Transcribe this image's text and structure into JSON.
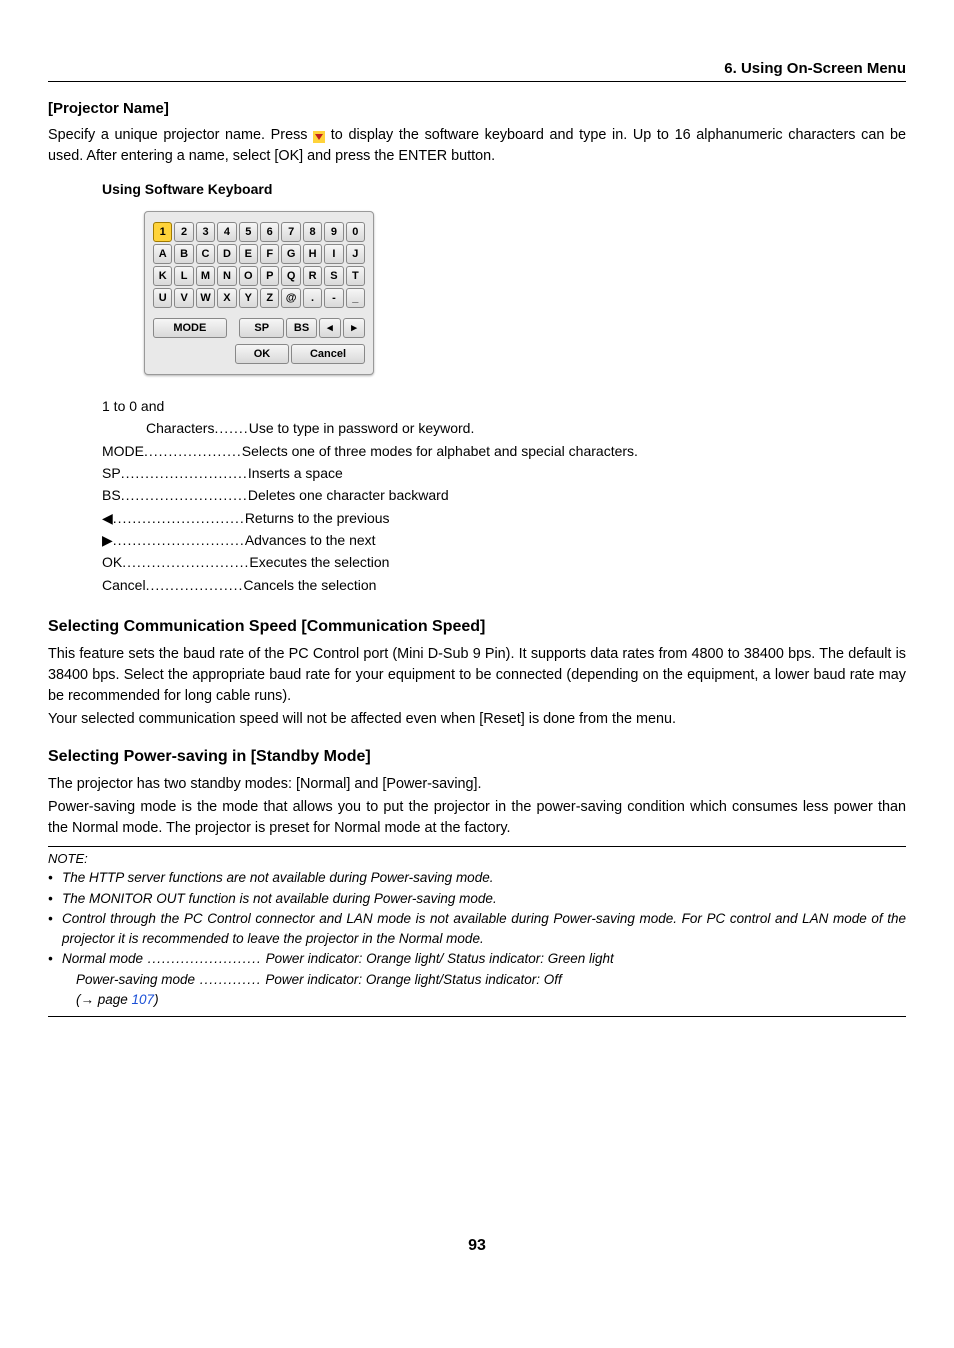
{
  "running_head": "6. Using On-Screen Menu",
  "projector": {
    "heading": "[Projector Name]",
    "para_a": "Specify a unique projector name. Press ",
    "para_b": " to display the software keyboard and type in. Up to 16 alphanumeric characters can be used. After entering a name, select [OK] and press the ENTER button.",
    "kbd_heading": "Using Software Keyboard"
  },
  "keyboard": {
    "row1": [
      "1",
      "2",
      "3",
      "4",
      "5",
      "6",
      "7",
      "8",
      "9",
      "0"
    ],
    "row2": [
      "A",
      "B",
      "C",
      "D",
      "E",
      "F",
      "G",
      "H",
      "I",
      "J"
    ],
    "row3": [
      "K",
      "L",
      "M",
      "N",
      "O",
      "P",
      "Q",
      "R",
      "S",
      "T"
    ],
    "row4": [
      "U",
      "V",
      "W",
      "X",
      "Y",
      "Z",
      "@",
      ".",
      "-",
      "_"
    ],
    "mode": "MODE",
    "sp": "SP",
    "bs": "BS",
    "left": "◂",
    "right": "▸",
    "ok": "OK",
    "cancel": "Cancel"
  },
  "defs": {
    "lead": "1 to 0 and",
    "chars_term": "Characters",
    "chars_dots": " .......",
    "chars_desc": " Use to type in password or keyword.",
    "mode_term": "MODE",
    "mode_dots": " ....................",
    "mode_desc": " Selects one of three modes for alphabet and special characters.",
    "sp_term": "SP",
    "sp_dots": " ..........................",
    "sp_desc": " Inserts a space",
    "bs_term": "BS",
    "bs_dots": " ..........................",
    "bs_desc": " Deletes one character backward",
    "left_term": "◀",
    "left_dots": " ...........................",
    "left_desc": " Returns to the previous",
    "right_term": "▶",
    "right_dots": " ...........................",
    "right_desc": " Advances to the next",
    "ok_term": "OK",
    "ok_dots": " ..........................",
    "ok_desc": " Executes the selection",
    "cancel_term": "Cancel",
    "cancel_dots": " ....................",
    "cancel_desc": " Cancels the selection"
  },
  "comm": {
    "heading": "Selecting Communication Speed [Communication Speed]",
    "p1": "This feature sets the baud rate of the PC Control port (Mini D-Sub 9 Pin). It supports data rates from 4800 to 38400 bps. The default is 38400 bps. Select the appropriate baud rate for your equipment to be connected (depending on the equipment, a lower baud rate may be recommended for long cable runs).",
    "p2": "Your selected communication speed will not be affected even when [Reset] is done from the menu."
  },
  "standby": {
    "heading": "Selecting Power-saving in [Standby Mode]",
    "p1": "The projector has two standby modes: [Normal] and [Power-saving].",
    "p2": "Power-saving mode is the mode that allows you to put the projector in the power-saving condition which consumes less power than the Normal mode. The projector is preset for Normal mode at the factory."
  },
  "note": {
    "label": "NOTE:",
    "b1": "The HTTP server functions are not available during Power-saving mode.",
    "b2": "The MONITOR OUT function is not available during Power-saving mode.",
    "b3": "Control through the PC Control connector and LAN mode is not available during Power-saving mode. For PC control and LAN mode of the projector it is recommended to leave the projector in the Normal mode.",
    "b4a_term": "Normal mode",
    "b4a_dots": " ........................",
    "b4a_desc": " Power indicator: Orange light/ Status indicator: Green light",
    "b4b_term": "Power-saving mode",
    "b4b_dots": " .............",
    "b4b_desc": " Power indicator: Orange light/Status indicator: Off",
    "b4c_a": "(→ page ",
    "b4c_link": "107",
    "b4c_b": ")"
  },
  "page_number": "93"
}
